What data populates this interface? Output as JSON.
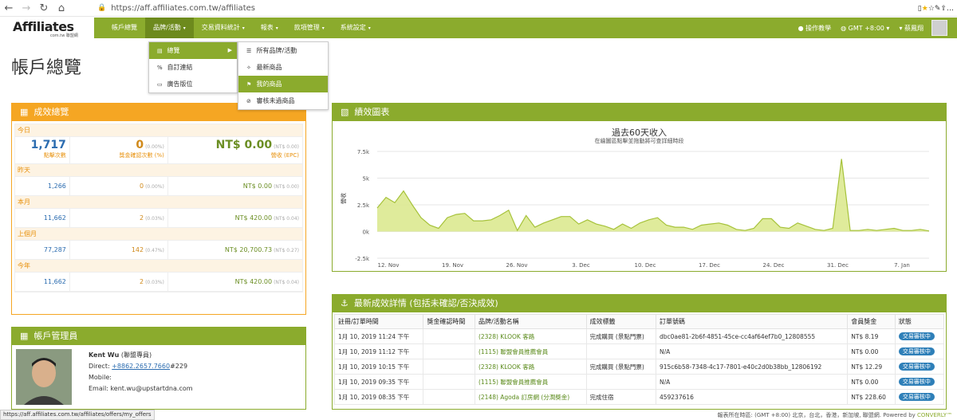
{
  "browser": {
    "url": "https://aff.affiliates.com.tw/affiliates"
  },
  "logo": {
    "text": "Affiliates",
    "sub": "com.tw 聯盟網"
  },
  "menu": [
    {
      "label": "帳戶總覽",
      "caret": false,
      "active": false
    },
    {
      "label": "品牌/活動",
      "caret": true,
      "active": true
    },
    {
      "label": "交易資料統計",
      "caret": true,
      "active": false
    },
    {
      "label": "報表",
      "caret": true,
      "active": false
    },
    {
      "label": "款項管理",
      "caret": true,
      "active": false
    },
    {
      "label": "系統設定",
      "caret": true,
      "active": false
    }
  ],
  "nav_right": {
    "help": "操作教學",
    "timezone": "GMT +8:00",
    "user": "蔡鳳翔"
  },
  "dropdown1": [
    {
      "label": "總覽",
      "icon": "▤"
    },
    {
      "label": "自訂連結",
      "icon": "%"
    },
    {
      "label": "廣告版位",
      "icon": "▭"
    }
  ],
  "dropdown2": [
    {
      "label": "所有品牌/活動",
      "icon": "☰"
    },
    {
      "label": "最新商品",
      "icon": "✧"
    },
    {
      "label": "我的商品",
      "icon": "⚑"
    },
    {
      "label": "審核未過商品",
      "icon": "⊘"
    }
  ],
  "page_title": "帳戶總覽",
  "summary": {
    "title": "成效總覽",
    "today": {
      "label": "今日",
      "clicks": "1,717",
      "clicks_label": "點擊次數",
      "conv": "0",
      "conv_pct": "(0.00%)",
      "conv_label": "獎金確認次數 (%)",
      "revenue": "NT$ 0.00",
      "epc": "(NT$ 0.00)",
      "rev_label": "營收 (EPC)"
    },
    "rows": [
      {
        "label": "昨天",
        "clicks": "1,266",
        "conv": "0",
        "pct": "(0.00%)",
        "rev": "NT$ 0.00",
        "epc": "(NT$ 0.00)"
      },
      {
        "label": "本月",
        "clicks": "11,662",
        "conv": "2",
        "pct": "(0.03%)",
        "rev": "NT$ 420.00",
        "epc": "(NT$ 0.04)"
      },
      {
        "label": "上個月",
        "clicks": "77,287",
        "conv": "142",
        "pct": "(0.47%)",
        "rev": "NT$ 20,700.73",
        "epc": "(NT$ 0.27)"
      },
      {
        "label": "今年",
        "clicks": "11,662",
        "conv": "2",
        "pct": "(0.03%)",
        "rev": "NT$ 420.00",
        "epc": "(NT$ 0.04)"
      }
    ]
  },
  "manager": {
    "title": "帳戶管理員",
    "name": "Kent Wu",
    "role": "(聯盟專員)",
    "direct_label": "Direct: ",
    "phone": "+8862.2657.7660",
    "ext": "#229",
    "mobile": "Mobile:",
    "email": "Email: kent.wu@upstartdna.com"
  },
  "chart_panel": {
    "title": "績效圖表"
  },
  "chart_data": {
    "type": "area",
    "title": "過去60天收入",
    "subtitle": "在繪圖區點擊並拖動將可查詳細時段",
    "ylabel": "營收",
    "ylim": [
      -2500,
      7500
    ],
    "yticks": [
      "7.5k",
      "5k",
      "2.5k",
      "0k",
      "-2.5k"
    ],
    "xticks": [
      "12. Nov",
      "19. Nov",
      "26. Nov",
      "3. Dec",
      "10. Dec",
      "17. Dec",
      "24. Dec",
      "31. Dec",
      "7. Jan"
    ],
    "values": [
      2200,
      3200,
      2700,
      3800,
      2500,
      1300,
      600,
      300,
      1300,
      1600,
      1700,
      1000,
      1000,
      1100,
      1500,
      2000,
      100,
      1500,
      400,
      800,
      1100,
      1400,
      1400,
      700,
      1100,
      700,
      500,
      200,
      700,
      300,
      800,
      1100,
      1300,
      600,
      400,
      400,
      200,
      600,
      700,
      800,
      600,
      200,
      100,
      300,
      1200,
      1200,
      400,
      300,
      800,
      500,
      200,
      100,
      300,
      6800,
      100,
      100,
      200,
      100,
      200,
      300,
      100,
      100,
      200,
      50
    ]
  },
  "recent": {
    "title": "最新成效詳情 (包括未確認/否決成效)",
    "headers": [
      "註冊/訂單時間",
      "獎金確認時間",
      "品牌/活動名稱",
      "成效標籤",
      "訂單號碼",
      "會員獎金",
      "狀態"
    ],
    "rows": [
      {
        "time": "1月 10, 2019 11:24 下午",
        "confirm": "",
        "offer": "(2328) KLOOK 客路",
        "tag": "完成購買 (景點門票)",
        "order": "dbc0ae81-2b6f-4851-45ce-cc4af64ef7b0_12808555",
        "amount": "NT$ 8.19",
        "status": "交易審核中"
      },
      {
        "time": "1月 10, 2019 11:12 下午",
        "confirm": "",
        "offer": "(1115) 聯盟會員推薦會員",
        "tag": "",
        "order": "N/A",
        "amount": "NT$ 0.00",
        "status": "交易審核中"
      },
      {
        "time": "1月 10, 2019 10:15 下午",
        "confirm": "",
        "offer": "(2328) KLOOK 客路",
        "tag": "完成購買 (景點門票)",
        "order": "915c6b58-7348-4c17-7801-e40c2d0b38bb_12806192",
        "amount": "NT$ 12.29",
        "status": "交易審核中"
      },
      {
        "time": "1月 10, 2019 09:35 下午",
        "confirm": "",
        "offer": "(1115) 聯盟會員推薦會員",
        "tag": "",
        "order": "N/A",
        "amount": "NT$ 0.00",
        "status": "交易審核中"
      },
      {
        "time": "1月 10, 2019 08:35 下午",
        "confirm": "",
        "offer": "(2148) Agoda 訂房網 (分潤獎金)",
        "tag": "完成住宿",
        "order": "459237616",
        "amount": "NT$ 228.60",
        "status": "交易審核中"
      }
    ]
  },
  "status_url": "https://aff.affiliates.com.tw/affiliates/offers/my_offers",
  "footer": {
    "text": "報表所在時區: (GMT +8:00) 北京，台北，香港，新加坡, 聯盟網. Powered by ",
    "brand": "CONVERLY™"
  }
}
